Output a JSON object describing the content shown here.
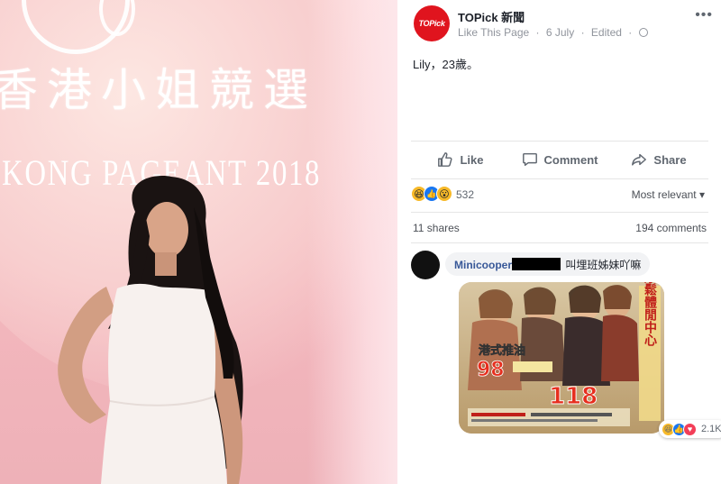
{
  "photo": {
    "backdrop_text_cn": "香港小姐競選",
    "backdrop_text_en": "KONG PAGEANT 2018"
  },
  "post": {
    "page_name": "TOPick 新聞",
    "avatar_text": "TOPick",
    "meta": {
      "like_link": "Like This Page",
      "date": "6 July",
      "edited": "Edited"
    },
    "text": "Lily，23歲。",
    "actions": {
      "like": "Like",
      "comment": "Comment",
      "share": "Share"
    },
    "reactions": {
      "count": "532",
      "sort": "Most relevant"
    },
    "stats": {
      "shares": "11 shares",
      "comments": "194 comments"
    },
    "comment": {
      "author": "Minicooper",
      "body": "叫埋班姊妹吖嘛",
      "reaction_count": "2.1K"
    },
    "comment_image": {
      "title_right": "按摩鬆體閒中心",
      "title_left": "港式推油",
      "price1": "98",
      "price2": "118"
    }
  },
  "colors": {
    "brand_red": "#e0141e",
    "link_blue": "#385898",
    "like_blue": "#1877f2"
  }
}
